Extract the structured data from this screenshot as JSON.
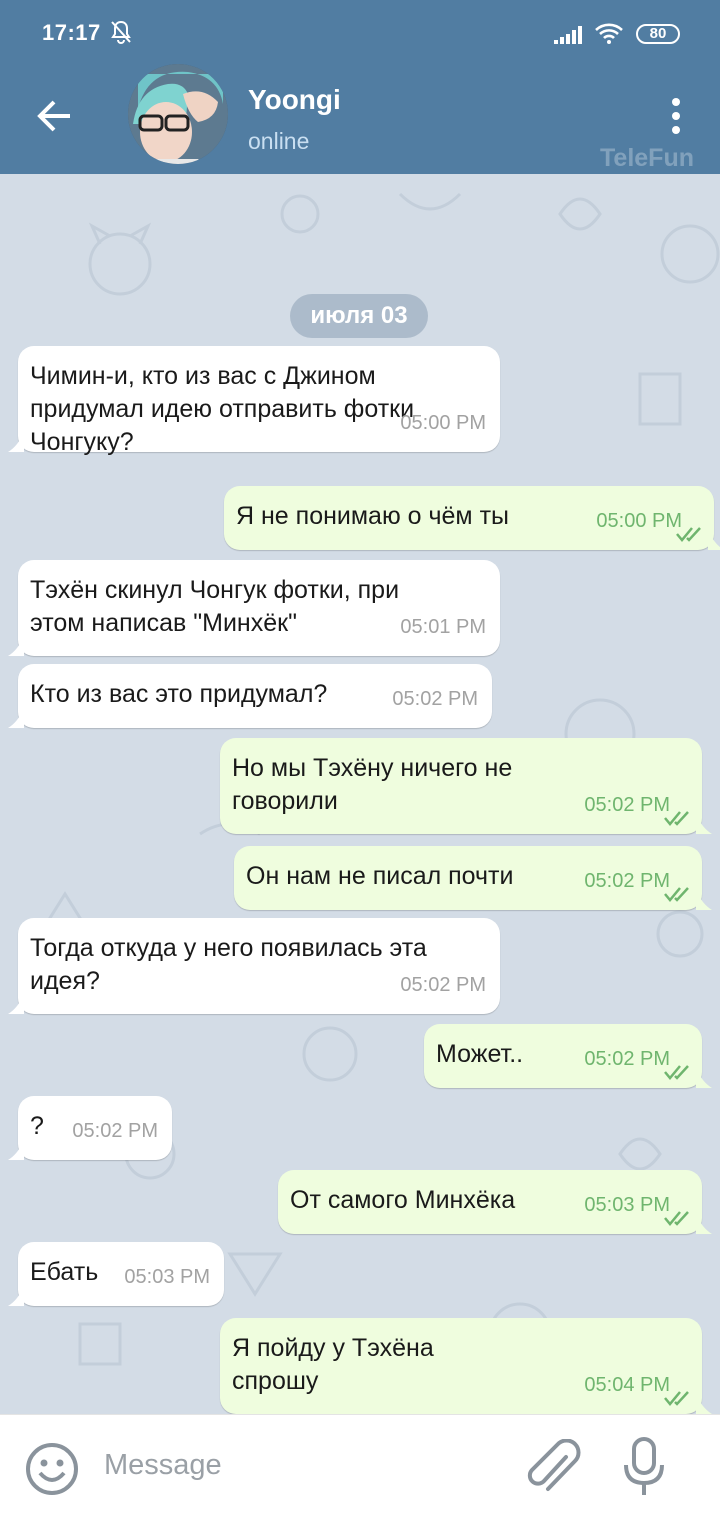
{
  "status_bar": {
    "time": "17:17",
    "battery": "80"
  },
  "header": {
    "name": "Yoongi",
    "status": "online",
    "watermark": "TeleFun"
  },
  "chat": {
    "date_label": "июля 03",
    "messages": [
      {
        "dir": "in",
        "text": "Чимин-и, кто из вас с Джином\nпридумал идею отправить фотки\nЧонгуку?",
        "time": "05:00 PM"
      },
      {
        "dir": "out",
        "text": "Я не понимаю о чём ты",
        "time": "05:00 PM"
      },
      {
        "dir": "in",
        "text": "Тэхён скинул Чонгук фотки, при\nэтом написав \"Минхёк\"",
        "time": "05:01 PM"
      },
      {
        "dir": "in",
        "text": "Кто из вас это придумал?",
        "time": "05:02 PM"
      },
      {
        "dir": "out",
        "text": "Но мы Тэхёну ничего не\nговорили",
        "time": "05:02 PM"
      },
      {
        "dir": "out",
        "text": "Он нам не писал почти",
        "time": "05:02 PM"
      },
      {
        "dir": "in",
        "text": "Тогда откуда у него появилась эта\nидея?",
        "time": "05:02 PM"
      },
      {
        "dir": "out",
        "text": "Может..",
        "time": "05:02 PM"
      },
      {
        "dir": "in",
        "text": "?",
        "time": "05:02 PM"
      },
      {
        "dir": "out",
        "text": "От самого Минхёка",
        "time": "05:03 PM"
      },
      {
        "dir": "in",
        "text": "Ебать",
        "time": "05:03 PM"
      },
      {
        "dir": "out",
        "text": "Я пойду у Тэхёна\nспрошу",
        "time": "05:04 PM"
      }
    ]
  },
  "input": {
    "placeholder": "Message"
  },
  "icons": {
    "back": "arrow-left-icon",
    "menu": "more-vertical-icon",
    "emoji": "smile-icon",
    "attach": "paperclip-icon",
    "mic": "microphone-icon",
    "read": "double-check-icon",
    "silent": "bell-off-icon",
    "signal": "signal-icon",
    "wifi": "wifi-icon"
  },
  "colors": {
    "header": "#517da2",
    "chat_bg": "#d3dce6",
    "bubble_in": "#ffffff",
    "bubble_out": "#effdde",
    "read_check": "#6fb56e"
  }
}
